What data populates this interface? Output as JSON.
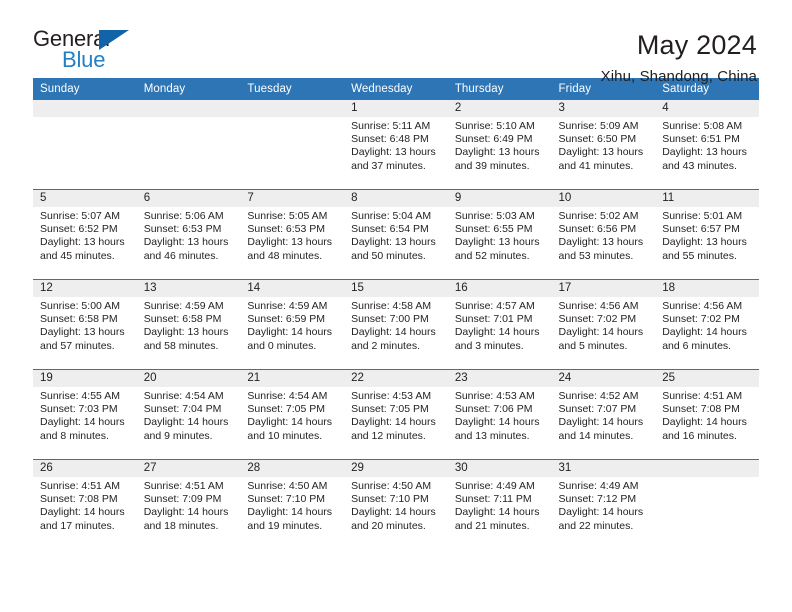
{
  "brand": {
    "name_part1": "General",
    "name_part2": "Blue",
    "triangle_color": "#1263a8",
    "blue_color": "#2580c3"
  },
  "header": {
    "title": "May 2024",
    "location": "Xihu, Shandong, China"
  },
  "theme": {
    "header_blue": "#2e75b6",
    "daynum_strip": "#eeeeee",
    "text": "#231f20"
  },
  "weekday_headers": [
    "Sunday",
    "Monday",
    "Tuesday",
    "Wednesday",
    "Thursday",
    "Friday",
    "Saturday"
  ],
  "weeks": [
    [
      {
        "day": "",
        "sunrise": "",
        "sunset": "",
        "daylight1": "",
        "daylight2": ""
      },
      {
        "day": "",
        "sunrise": "",
        "sunset": "",
        "daylight1": "",
        "daylight2": ""
      },
      {
        "day": "",
        "sunrise": "",
        "sunset": "",
        "daylight1": "",
        "daylight2": ""
      },
      {
        "day": "1",
        "sunrise": "Sunrise: 5:11 AM",
        "sunset": "Sunset: 6:48 PM",
        "daylight1": "Daylight: 13 hours",
        "daylight2": "and 37 minutes."
      },
      {
        "day": "2",
        "sunrise": "Sunrise: 5:10 AM",
        "sunset": "Sunset: 6:49 PM",
        "daylight1": "Daylight: 13 hours",
        "daylight2": "and 39 minutes."
      },
      {
        "day": "3",
        "sunrise": "Sunrise: 5:09 AM",
        "sunset": "Sunset: 6:50 PM",
        "daylight1": "Daylight: 13 hours",
        "daylight2": "and 41 minutes."
      },
      {
        "day": "4",
        "sunrise": "Sunrise: 5:08 AM",
        "sunset": "Sunset: 6:51 PM",
        "daylight1": "Daylight: 13 hours",
        "daylight2": "and 43 minutes."
      }
    ],
    [
      {
        "day": "5",
        "sunrise": "Sunrise: 5:07 AM",
        "sunset": "Sunset: 6:52 PM",
        "daylight1": "Daylight: 13 hours",
        "daylight2": "and 45 minutes."
      },
      {
        "day": "6",
        "sunrise": "Sunrise: 5:06 AM",
        "sunset": "Sunset: 6:53 PM",
        "daylight1": "Daylight: 13 hours",
        "daylight2": "and 46 minutes."
      },
      {
        "day": "7",
        "sunrise": "Sunrise: 5:05 AM",
        "sunset": "Sunset: 6:53 PM",
        "daylight1": "Daylight: 13 hours",
        "daylight2": "and 48 minutes."
      },
      {
        "day": "8",
        "sunrise": "Sunrise: 5:04 AM",
        "sunset": "Sunset: 6:54 PM",
        "daylight1": "Daylight: 13 hours",
        "daylight2": "and 50 minutes."
      },
      {
        "day": "9",
        "sunrise": "Sunrise: 5:03 AM",
        "sunset": "Sunset: 6:55 PM",
        "daylight1": "Daylight: 13 hours",
        "daylight2": "and 52 minutes."
      },
      {
        "day": "10",
        "sunrise": "Sunrise: 5:02 AM",
        "sunset": "Sunset: 6:56 PM",
        "daylight1": "Daylight: 13 hours",
        "daylight2": "and 53 minutes."
      },
      {
        "day": "11",
        "sunrise": "Sunrise: 5:01 AM",
        "sunset": "Sunset: 6:57 PM",
        "daylight1": "Daylight: 13 hours",
        "daylight2": "and 55 minutes."
      }
    ],
    [
      {
        "day": "12",
        "sunrise": "Sunrise: 5:00 AM",
        "sunset": "Sunset: 6:58 PM",
        "daylight1": "Daylight: 13 hours",
        "daylight2": "and 57 minutes."
      },
      {
        "day": "13",
        "sunrise": "Sunrise: 4:59 AM",
        "sunset": "Sunset: 6:58 PM",
        "daylight1": "Daylight: 13 hours",
        "daylight2": "and 58 minutes."
      },
      {
        "day": "14",
        "sunrise": "Sunrise: 4:59 AM",
        "sunset": "Sunset: 6:59 PM",
        "daylight1": "Daylight: 14 hours",
        "daylight2": "and 0 minutes."
      },
      {
        "day": "15",
        "sunrise": "Sunrise: 4:58 AM",
        "sunset": "Sunset: 7:00 PM",
        "daylight1": "Daylight: 14 hours",
        "daylight2": "and 2 minutes."
      },
      {
        "day": "16",
        "sunrise": "Sunrise: 4:57 AM",
        "sunset": "Sunset: 7:01 PM",
        "daylight1": "Daylight: 14 hours",
        "daylight2": "and 3 minutes."
      },
      {
        "day": "17",
        "sunrise": "Sunrise: 4:56 AM",
        "sunset": "Sunset: 7:02 PM",
        "daylight1": "Daylight: 14 hours",
        "daylight2": "and 5 minutes."
      },
      {
        "day": "18",
        "sunrise": "Sunrise: 4:56 AM",
        "sunset": "Sunset: 7:02 PM",
        "daylight1": "Daylight: 14 hours",
        "daylight2": "and 6 minutes."
      }
    ],
    [
      {
        "day": "19",
        "sunrise": "Sunrise: 4:55 AM",
        "sunset": "Sunset: 7:03 PM",
        "daylight1": "Daylight: 14 hours",
        "daylight2": "and 8 minutes."
      },
      {
        "day": "20",
        "sunrise": "Sunrise: 4:54 AM",
        "sunset": "Sunset: 7:04 PM",
        "daylight1": "Daylight: 14 hours",
        "daylight2": "and 9 minutes."
      },
      {
        "day": "21",
        "sunrise": "Sunrise: 4:54 AM",
        "sunset": "Sunset: 7:05 PM",
        "daylight1": "Daylight: 14 hours",
        "daylight2": "and 10 minutes."
      },
      {
        "day": "22",
        "sunrise": "Sunrise: 4:53 AM",
        "sunset": "Sunset: 7:05 PM",
        "daylight1": "Daylight: 14 hours",
        "daylight2": "and 12 minutes."
      },
      {
        "day": "23",
        "sunrise": "Sunrise: 4:53 AM",
        "sunset": "Sunset: 7:06 PM",
        "daylight1": "Daylight: 14 hours",
        "daylight2": "and 13 minutes."
      },
      {
        "day": "24",
        "sunrise": "Sunrise: 4:52 AM",
        "sunset": "Sunset: 7:07 PM",
        "daylight1": "Daylight: 14 hours",
        "daylight2": "and 14 minutes."
      },
      {
        "day": "25",
        "sunrise": "Sunrise: 4:51 AM",
        "sunset": "Sunset: 7:08 PM",
        "daylight1": "Daylight: 14 hours",
        "daylight2": "and 16 minutes."
      }
    ],
    [
      {
        "day": "26",
        "sunrise": "Sunrise: 4:51 AM",
        "sunset": "Sunset: 7:08 PM",
        "daylight1": "Daylight: 14 hours",
        "daylight2": "and 17 minutes."
      },
      {
        "day": "27",
        "sunrise": "Sunrise: 4:51 AM",
        "sunset": "Sunset: 7:09 PM",
        "daylight1": "Daylight: 14 hours",
        "daylight2": "and 18 minutes."
      },
      {
        "day": "28",
        "sunrise": "Sunrise: 4:50 AM",
        "sunset": "Sunset: 7:10 PM",
        "daylight1": "Daylight: 14 hours",
        "daylight2": "and 19 minutes."
      },
      {
        "day": "29",
        "sunrise": "Sunrise: 4:50 AM",
        "sunset": "Sunset: 7:10 PM",
        "daylight1": "Daylight: 14 hours",
        "daylight2": "and 20 minutes."
      },
      {
        "day": "30",
        "sunrise": "Sunrise: 4:49 AM",
        "sunset": "Sunset: 7:11 PM",
        "daylight1": "Daylight: 14 hours",
        "daylight2": "and 21 minutes."
      },
      {
        "day": "31",
        "sunrise": "Sunrise: 4:49 AM",
        "sunset": "Sunset: 7:12 PM",
        "daylight1": "Daylight: 14 hours",
        "daylight2": "and 22 minutes."
      },
      {
        "day": "",
        "sunrise": "",
        "sunset": "",
        "daylight1": "",
        "daylight2": ""
      }
    ]
  ]
}
